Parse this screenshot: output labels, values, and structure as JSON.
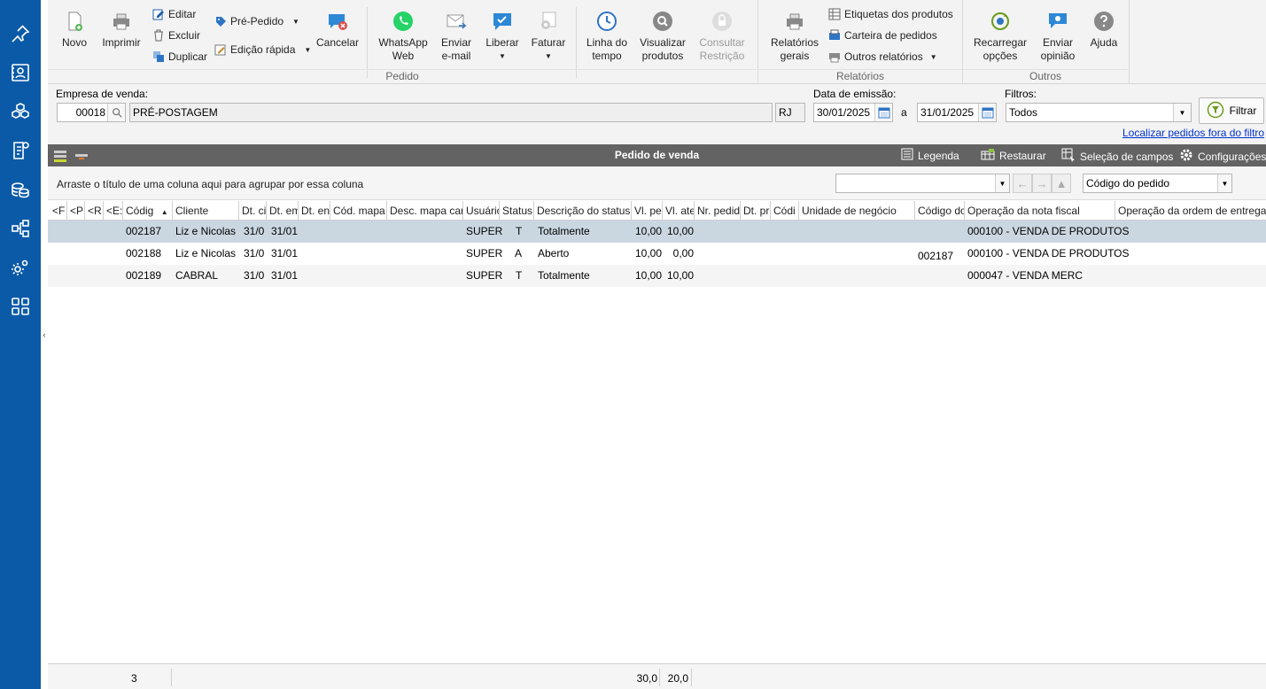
{
  "sidebar": {
    "icons": [
      "pin-icon",
      "contacts-icon",
      "boxes-icon",
      "invoice-icon",
      "coins-icon",
      "workflow-icon",
      "settings-icon",
      "apps-icon"
    ]
  },
  "ribbon": {
    "novo": "Novo",
    "imprimir": "Imprimir",
    "editar": "Editar",
    "excluir": "Excluir",
    "duplicar": "Duplicar",
    "pre_pedido": "Pré-Pedido",
    "edicao_rapida": "Edição rápida",
    "cancelar": "Cancelar",
    "whatsapp": [
      "WhatsApp",
      "Web"
    ],
    "enviar_email": [
      "Enviar",
      "e-mail"
    ],
    "liberar": "Liberar",
    "faturar": "Faturar",
    "linha_tempo": [
      "Linha do",
      "tempo"
    ],
    "visualizar": [
      "Visualizar",
      "produtos"
    ],
    "consultar": [
      "Consultar",
      "Restrição"
    ],
    "relatorios_gerais": [
      "Relatórios",
      "gerais"
    ],
    "etiquetas": "Etiquetas dos produtos",
    "carteira": "Carteira de pedidos",
    "outros_relatorios": "Outros relatórios",
    "recarregar": [
      "Recarregar",
      "opções"
    ],
    "enviar_opiniao": [
      "Enviar",
      "opinião"
    ],
    "ajuda": "Ajuda",
    "group_pedido": "Pedido",
    "group_relatorios": "Relatórios",
    "group_outros": "Outros"
  },
  "filters": {
    "empresa_label": "Empresa de venda:",
    "empresa_code": "00018",
    "empresa_name": "PRÉ-POSTAGEM",
    "uf": "RJ",
    "data_label": "Data de emissão:",
    "data_de": "30/01/2025",
    "a": "a",
    "data_ate": "31/01/2025",
    "filtros_label": "Filtros:",
    "filtros_value": "Todos",
    "filtrar": "Filtrar",
    "localizar_link": "Localizar pedidos fora do filtro"
  },
  "grid": {
    "title": "Pedido de venda",
    "legenda": "Legenda",
    "restaurar": "Restaurar",
    "selecao": "Seleção de campos",
    "configuracoes": "Configurações",
    "group_hint": "Arraste o título de uma coluna aqui para agrupar por essa coluna",
    "search_value": "",
    "sort_value": "Código do pedido",
    "columns": [
      "<F",
      "<P",
      "<R",
      "<E:",
      "Códig",
      "Cliente",
      "Dt. ci",
      "Dt. em",
      "Dt. en",
      "Cód. mapa",
      "Desc. mapa car",
      "Usuário",
      "Status",
      "Descrição do status",
      "Vl. pe",
      "Vl. ate",
      "Nr. pedid",
      "Dt. pr",
      "Códi",
      "Unidade de negócio",
      "Código do",
      "Operação da nota fiscal",
      "Operação da ordem de entrega"
    ],
    "rows": [
      {
        "codigo": "002187",
        "cliente": "Liz e Nicolas",
        "dtc": "31/0",
        "dte": "31/01",
        "usuario": "SUPER",
        "status": "T",
        "descricao": "Totalmente",
        "vlpe": "10,00",
        "vlate": "10,00",
        "codigo_do": "",
        "operacao": "000100 - VENDA DE PRODUTOS"
      },
      {
        "codigo": "002188",
        "cliente": "Liz e Nicolas",
        "dtc": "31/0",
        "dte": "31/01",
        "usuario": "SUPER",
        "status": "A",
        "descricao": "Aberto",
        "vlpe": "10,00",
        "vlate": "0,00",
        "codigo_do": "002187",
        "operacao": "000100 - VENDA DE PRODUTOS"
      },
      {
        "codigo": "002189",
        "cliente": "CABRAL",
        "dtc": "31/0",
        "dte": "31/01",
        "usuario": "SUPER",
        "status": "T",
        "descricao": "Totalmente",
        "vlpe": "10,00",
        "vlate": "10,00",
        "codigo_do": "",
        "operacao": "000047 - VENDA MERC"
      }
    ],
    "footer_count": "3",
    "footer_vlpe": "30,0",
    "footer_vlate": "20,0"
  }
}
